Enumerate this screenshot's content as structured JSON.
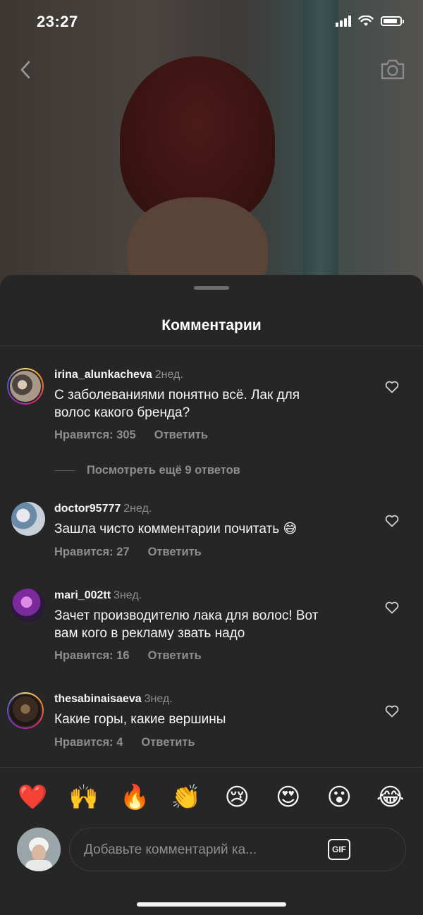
{
  "status_bar": {
    "time": "23:27"
  },
  "header": {
    "title": "Комментарии"
  },
  "comments": [
    {
      "username": "irina_alunkacheva",
      "when": "2нед.",
      "text_line1": "С заболеваниями понятно всё. Лак для",
      "text_line2": "волос какого бренда?",
      "likes": "Нравится: 305",
      "reply": "Ответить"
    },
    {
      "username": "doctor95777",
      "when": "2нед.",
      "text_line1": "Зашла чисто комментарии почитать 😅",
      "text_line2": "",
      "likes": "Нравится: 27",
      "reply": "Ответить"
    },
    {
      "username": "mari_002tt",
      "when": "3нед.",
      "text_line1": "Зачет производителю лака для волос! Вот",
      "text_line2": "вам кого в рекламу звать надо",
      "likes": "Нравится: 16",
      "reply": "Ответить"
    },
    {
      "username": "thesabinaisaeva",
      "when": "3нед.",
      "text_line1": "Какие горы, какие вершины",
      "text_line2": "",
      "likes": "Нравится: 4",
      "reply": "Ответить"
    }
  ],
  "more_replies": "Посмотреть ещё 9 ответов",
  "emoji_bar": [
    "❤️",
    "🙌",
    "🔥",
    "👏",
    "😢",
    "😍",
    "😮",
    "😂"
  ],
  "composer": {
    "placeholder": "Добавьте комментарий ка...",
    "gif_label": "GIF"
  }
}
